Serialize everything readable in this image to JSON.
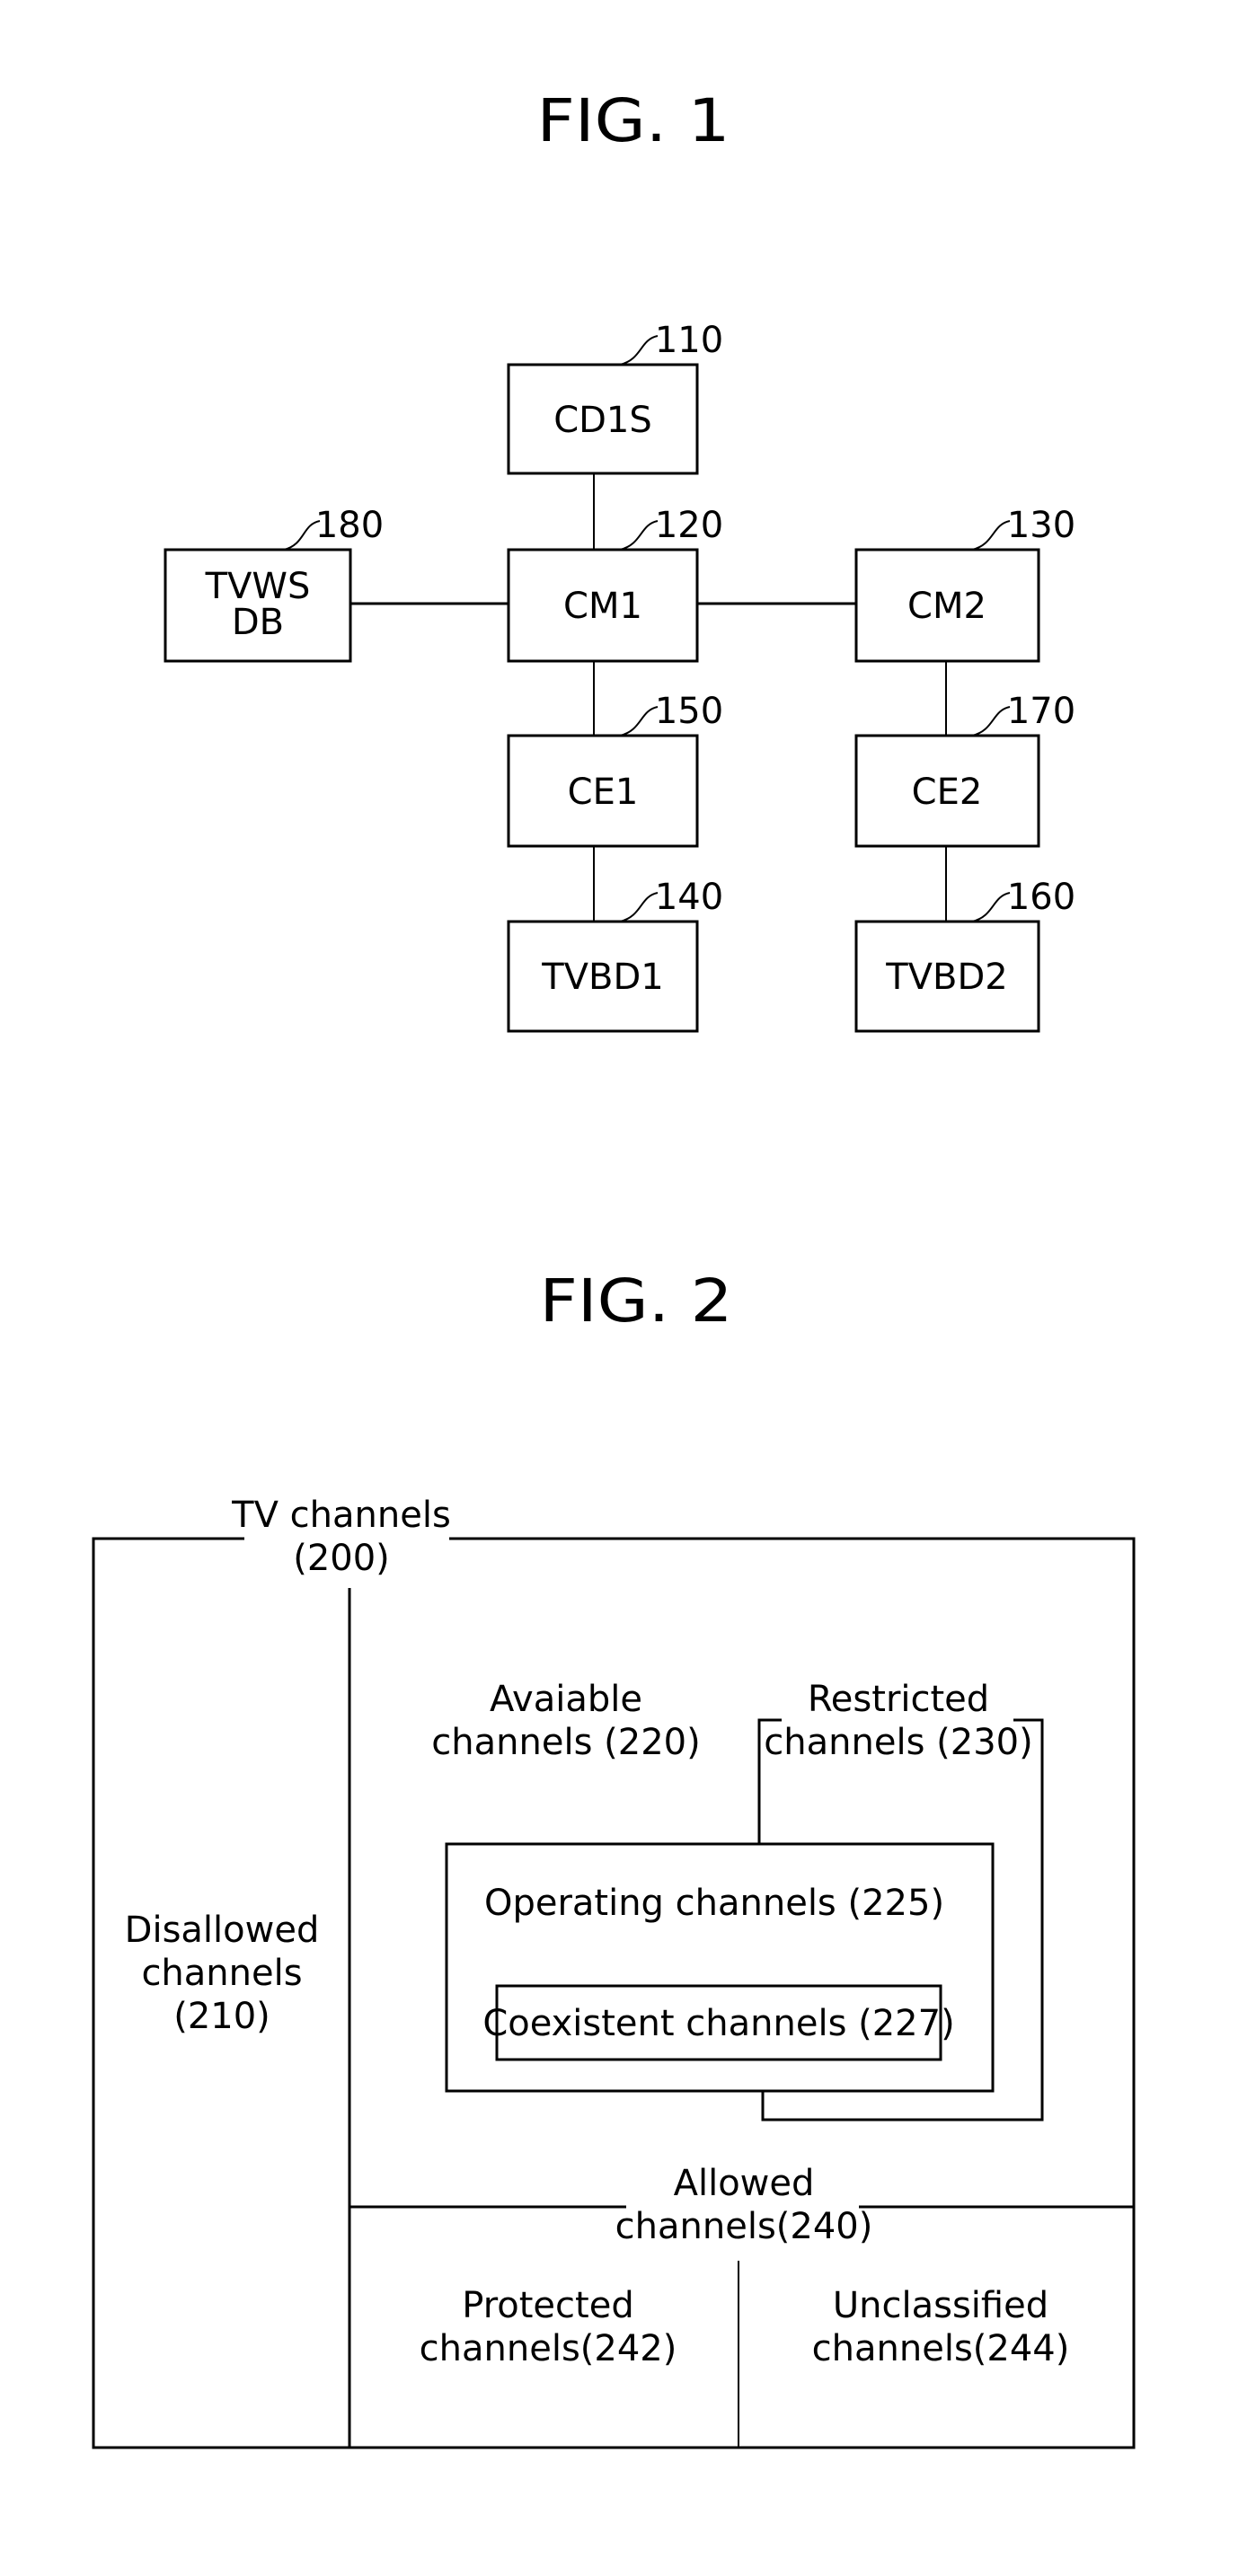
{
  "fig1": {
    "title": "FIG. 1",
    "blocks": [
      {
        "id": "cd1s",
        "label": "CD1S",
        "ref": "110"
      },
      {
        "id": "cm1",
        "label": "CM1",
        "ref": "120"
      },
      {
        "id": "cm2",
        "label": "CM2",
        "ref": "130"
      },
      {
        "id": "tvwsdb",
        "label_line1": "TVWS",
        "label_line2": "DB",
        "ref": "180"
      },
      {
        "id": "ce1",
        "label": "CE1",
        "ref": "150"
      },
      {
        "id": "ce2",
        "label": "CE2",
        "ref": "170"
      },
      {
        "id": "tvbd1",
        "label": "TVBD1",
        "ref": "140"
      },
      {
        "id": "tvbd2",
        "label": "TVBD2",
        "ref": "160"
      }
    ],
    "connections": [
      [
        "cd1s",
        "cm1"
      ],
      [
        "tvwsdb",
        "cm1"
      ],
      [
        "cm1",
        "cm2"
      ],
      [
        "cm1",
        "ce1"
      ],
      [
        "ce1",
        "tvbd1"
      ],
      [
        "cm2",
        "ce2"
      ],
      [
        "ce2",
        "tvbd2"
      ]
    ]
  },
  "fig2": {
    "title": "FIG. 2",
    "tv_channels": {
      "line1": "TV channels",
      "line2": "(200)"
    },
    "disallowed": {
      "line1": "Disallowed",
      "line2": "channels",
      "line3": "(210)"
    },
    "available": {
      "line1": "Avaiable",
      "line2": "channels (220)"
    },
    "restricted": {
      "line1": "Restricted",
      "line2": "channels (230)"
    },
    "operating": {
      "label": "Operating channels (225)"
    },
    "coexistent": {
      "label": "Coexistent channels (227)"
    },
    "allowed": {
      "line1": "Allowed",
      "line2": "channels(240)"
    },
    "protected": {
      "line1": "Protected",
      "line2": "channels(242)"
    },
    "unclassified": {
      "line1": "Unclassified",
      "line2": "channels(244)"
    }
  }
}
